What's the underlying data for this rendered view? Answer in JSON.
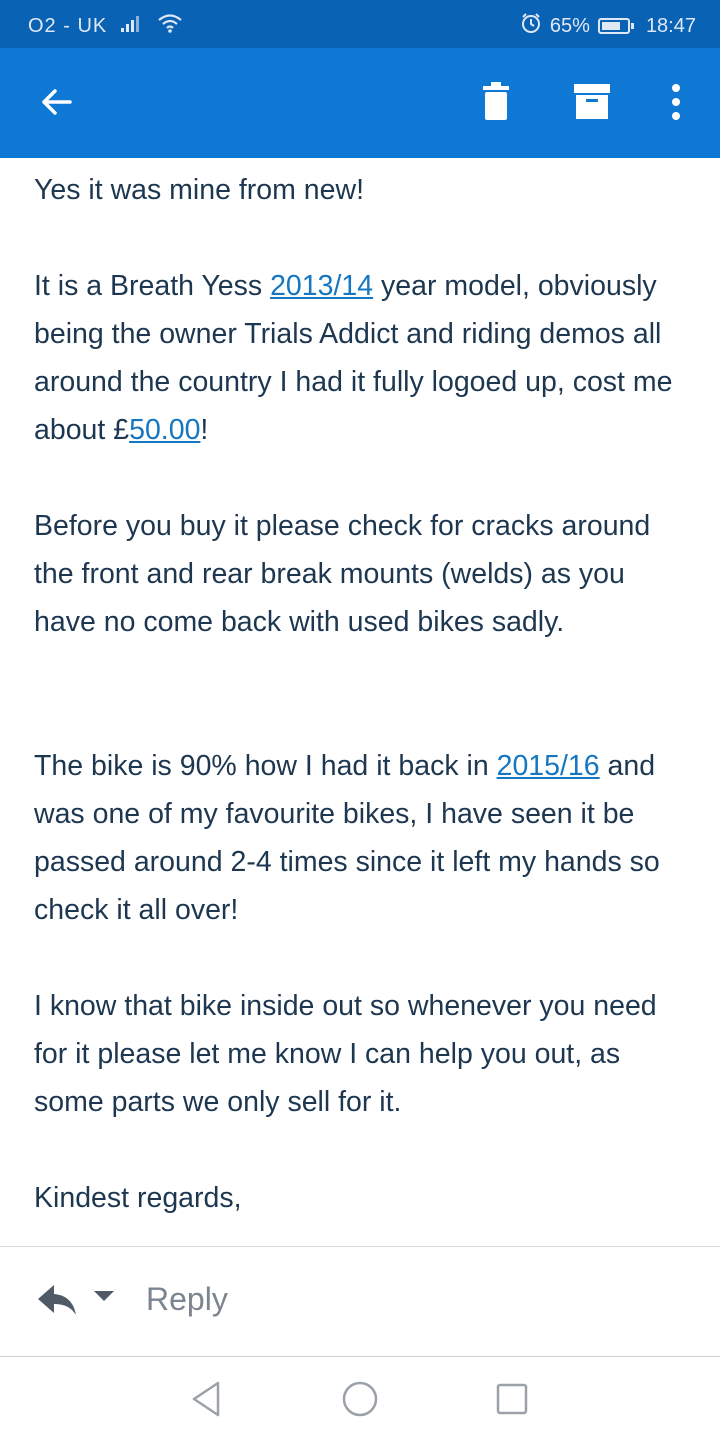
{
  "status_bar": {
    "carrier": "O2 - UK",
    "battery": "65%",
    "time": "18:47"
  },
  "app_bar": {
    "back_icon": "arrow-left-icon",
    "delete_icon": "trash-icon",
    "archive_icon": "archive-icon",
    "more_icon": "more-vert-icon"
  },
  "message": {
    "p1": "Yes it was mine from new!",
    "p2_a": "It is a Breath Yess ",
    "p2_link1": "2013/14",
    "p2_b": " year model, obviously being the owner Trials Addict and riding demos all around the country I had it fully logoed up, cost me about £",
    "p2_link2": "50.00",
    "p2_c": "!",
    "p3": "Before you buy it please check for cracks around the front and rear break mounts (welds) as you have no come back with used bikes sadly.",
    "p4_a": "The bike is 90% how I had it back in ",
    "p4_link": "2015/16",
    "p4_b": " and was one of my favourite bikes, I have seen it be passed around 2-4 times since it left my hands so check it all over!",
    "p5": "I know that bike inside out so whenever you need for it please let me know I can help you out, as some parts we only sell for it.",
    "p6": "Kindest regards,"
  },
  "reply_bar": {
    "label": "Reply"
  },
  "colors": {
    "status_bar": "#0a62b5",
    "app_bar": "#0e78d4",
    "link": "#1576c2",
    "body_text": "#1e3750"
  }
}
